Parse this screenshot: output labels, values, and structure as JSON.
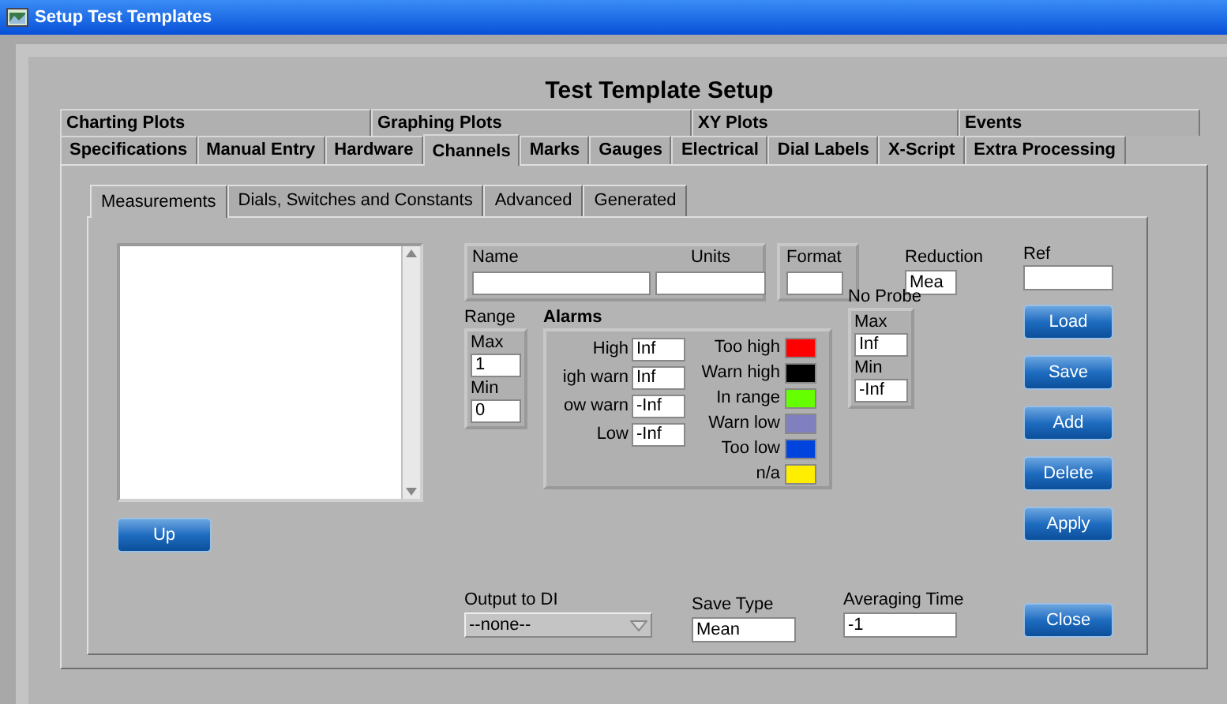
{
  "window": {
    "title": "Setup Test Templates"
  },
  "heading": "Test Template Setup",
  "tabs_row1": [
    {
      "label": "Charting Plots",
      "selected": false
    },
    {
      "label": "Graphing Plots",
      "selected": false
    },
    {
      "label": "XY Plots",
      "selected": false
    },
    {
      "label": "Events",
      "selected": false
    }
  ],
  "tabs_row2": [
    {
      "label": "Specifications",
      "selected": false
    },
    {
      "label": "Manual Entry",
      "selected": false
    },
    {
      "label": "Hardware",
      "selected": false
    },
    {
      "label": "Channels",
      "selected": true
    },
    {
      "label": "Marks",
      "selected": false
    },
    {
      "label": "Gauges",
      "selected": false
    },
    {
      "label": "Electrical",
      "selected": false
    },
    {
      "label": "Dial Labels",
      "selected": false
    },
    {
      "label": "X-Script",
      "selected": false
    },
    {
      "label": "Extra Processing",
      "selected": false
    }
  ],
  "subtabs": [
    {
      "label": "Measurements",
      "selected": true
    },
    {
      "label": "Dials, Switches and Constants",
      "selected": false
    },
    {
      "label": "Advanced",
      "selected": false
    },
    {
      "label": "Generated",
      "selected": false
    }
  ],
  "up_button": "Up",
  "name_units": {
    "name_label": "Name",
    "units_label": "Units"
  },
  "format": {
    "label": "Format"
  },
  "reduction": {
    "label": "Reduction",
    "value": "Mea"
  },
  "ref": {
    "label": "Ref"
  },
  "range": {
    "label": "Range",
    "max_label": "Max",
    "max": "1",
    "min_label": "Min",
    "min": "0"
  },
  "alarms": {
    "label": "Alarms",
    "limits": [
      {
        "label": "High",
        "value": "Inf"
      },
      {
        "label": "igh warn",
        "value": "Inf"
      },
      {
        "label": "ow warn",
        "value": "-Inf"
      },
      {
        "label": "Low",
        "value": "-Inf"
      }
    ],
    "colors": [
      {
        "label": "Too high",
        "color": "#ff0000"
      },
      {
        "label": "Warn high",
        "color": "#000000"
      },
      {
        "label": "In range",
        "color": "#66ff00"
      },
      {
        "label": "Warn low",
        "color": "#8080c0"
      },
      {
        "label": "Too low",
        "color": "#0044dd"
      },
      {
        "label": "n/a",
        "color": "#ffee00"
      }
    ]
  },
  "no_probe": {
    "label": "No Probe",
    "max_label": "Max",
    "max": "Inf",
    "min_label": "Min",
    "min": "-Inf"
  },
  "buttons": [
    "Load",
    "Save",
    "Add",
    "Delete",
    "Apply"
  ],
  "output_to_di": {
    "label": "Output to DI",
    "value": "--none--"
  },
  "save_type": {
    "label": "Save Type",
    "value": "Mean"
  },
  "averaging_time": {
    "label": "Averaging Time",
    "value": "-1"
  },
  "close_button": "Close"
}
